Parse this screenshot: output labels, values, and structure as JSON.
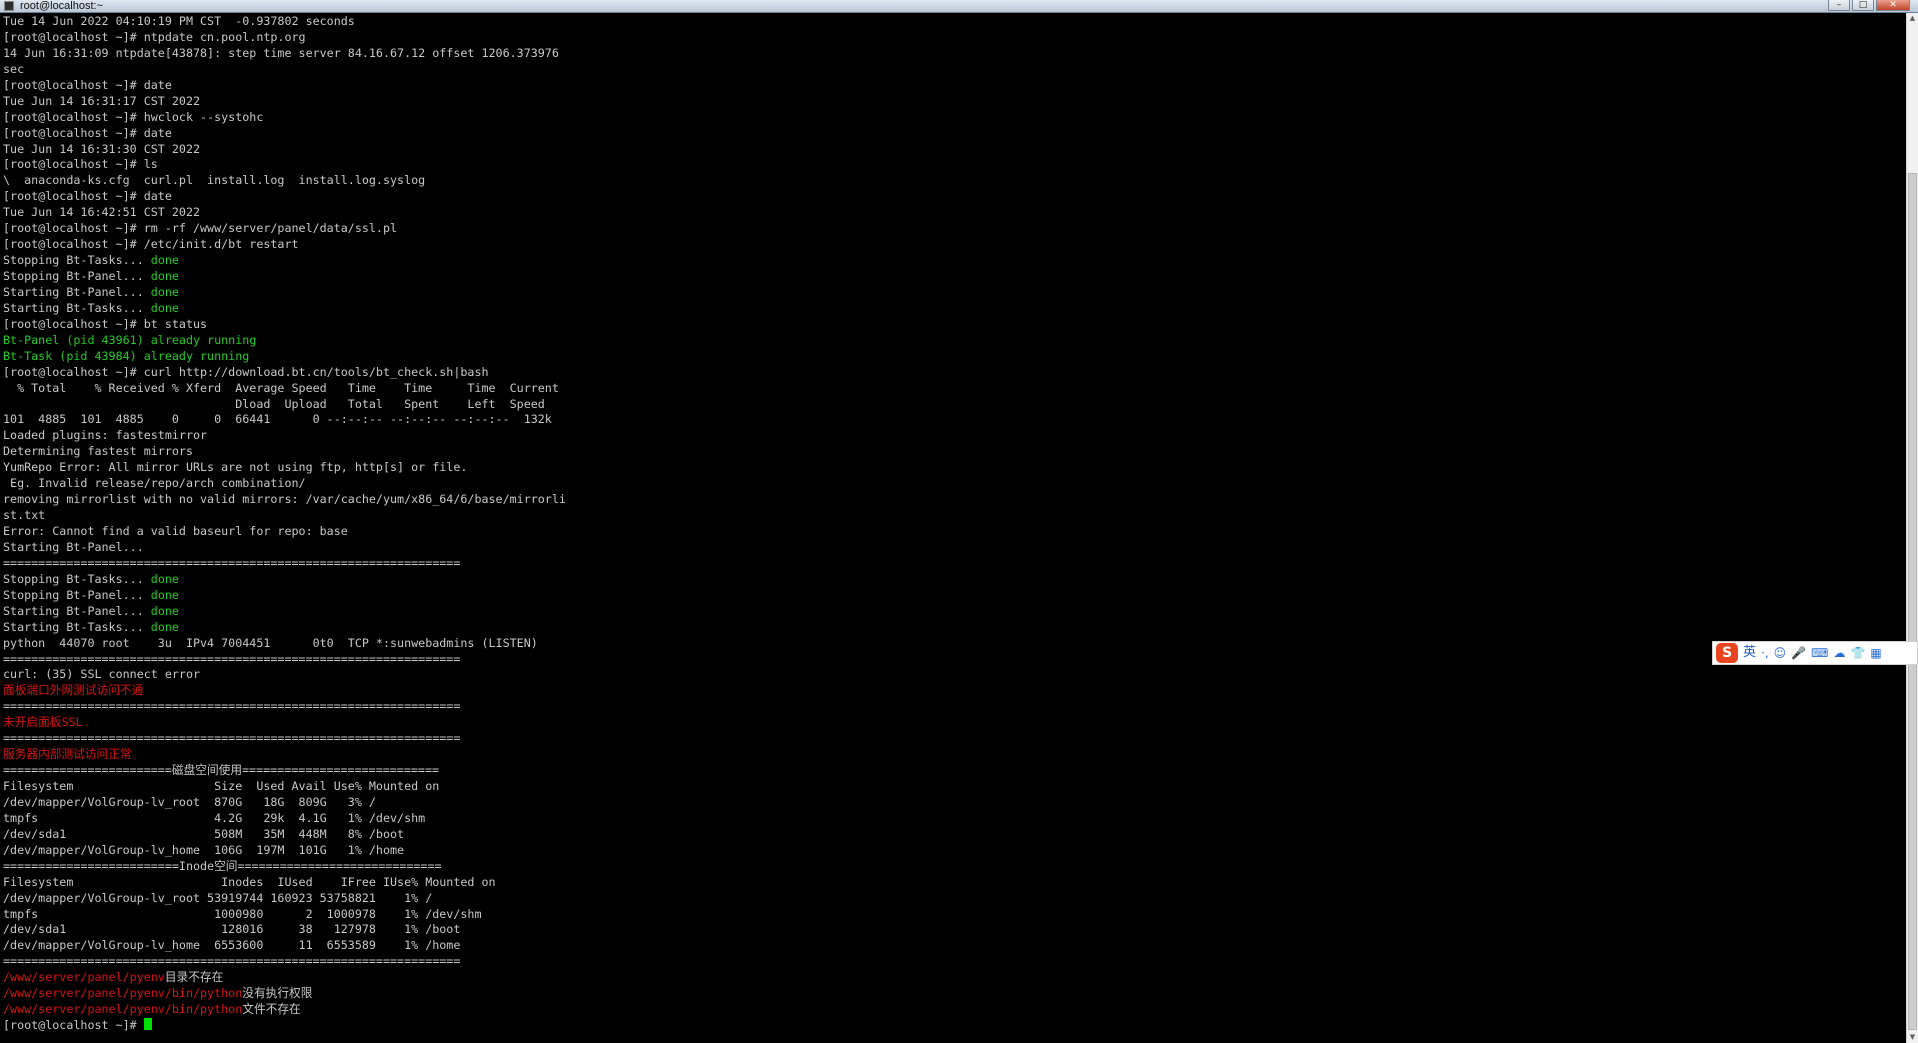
{
  "window": {
    "title": "root@localhost:~",
    "minimize_glyph": "–",
    "maximize_glyph": "□",
    "close_glyph": "✕"
  },
  "terminal": {
    "lines": [
      [
        {
          "t": "Tue 14 Jun 2022 04:10:19 PM CST  -0.937802 seconds"
        }
      ],
      [
        {
          "t": "[root@localhost ~]# ntpdate cn.pool.ntp.org"
        }
      ],
      [
        {
          "t": "14 Jun 16:31:09 ntpdate[43878]: step time server 84.16.67.12 offset 1206.373976"
        }
      ],
      [
        {
          "t": "sec"
        }
      ],
      [
        {
          "t": "[root@localhost ~]# date"
        }
      ],
      [
        {
          "t": "Tue Jun 14 16:31:17 CST 2022"
        }
      ],
      [
        {
          "t": "[root@localhost ~]# hwclock --systohc"
        }
      ],
      [
        {
          "t": "[root@localhost ~]# date"
        }
      ],
      [
        {
          "t": "Tue Jun 14 16:31:30 CST 2022"
        }
      ],
      [
        {
          "t": "[root@localhost ~]# ls"
        }
      ],
      [
        {
          "t": "\\  anaconda-ks.cfg  curl.pl  install.log  install.log.syslog"
        }
      ],
      [
        {
          "t": "[root@localhost ~]# date"
        }
      ],
      [
        {
          "t": "Tue Jun 14 16:42:51 CST 2022"
        }
      ],
      [
        {
          "t": "[root@localhost ~]# rm -rf /www/server/panel/data/ssl.pl"
        }
      ],
      [
        {
          "t": "[root@localhost ~]# /etc/init.d/bt restart"
        }
      ],
      [
        {
          "t": "Stopping Bt-Tasks... "
        },
        {
          "t": "done",
          "c": "g"
        }
      ],
      [
        {
          "t": "Stopping Bt-Panel... "
        },
        {
          "t": "done",
          "c": "g"
        }
      ],
      [
        {
          "t": "Starting Bt-Panel... "
        },
        {
          "t": "done",
          "c": "g"
        }
      ],
      [
        {
          "t": "Starting Bt-Tasks... "
        },
        {
          "t": "done",
          "c": "g"
        }
      ],
      [
        {
          "t": "[root@localhost ~]# bt status"
        }
      ],
      [
        {
          "t": "Bt-Panel (pid 43961) already running",
          "c": "g"
        }
      ],
      [
        {
          "t": "Bt-Task (pid 43984) already running",
          "c": "g"
        }
      ],
      [
        {
          "t": "[root@localhost ~]# curl http://download.bt.cn/tools/bt_check.sh|bash"
        }
      ],
      [
        {
          "t": "  % Total    % Received % Xferd  Average Speed   Time    Time     Time  Current"
        }
      ],
      [
        {
          "t": "                                 Dload  Upload   Total   Spent    Left  Speed"
        }
      ],
      [
        {
          "t": "101  4885  101  4885    0     0  66441      0 --:--:-- --:--:-- --:--:--  132k"
        }
      ],
      [
        {
          "t": "Loaded plugins: fastestmirror"
        }
      ],
      [
        {
          "t": "Determining fastest mirrors"
        }
      ],
      [
        {
          "t": "YumRepo Error: All mirror URLs are not using ftp, http[s] or file."
        }
      ],
      [
        {
          "t": " Eg. Invalid release/repo/arch combination/"
        }
      ],
      [
        {
          "t": "removing mirrorlist with no valid mirrors: /var/cache/yum/x86_64/6/base/mirrorli"
        }
      ],
      [
        {
          "t": "st.txt"
        }
      ],
      [
        {
          "t": "Error: Cannot find a valid baseurl for repo: base"
        }
      ],
      [
        {
          "t": "Starting Bt-Panel..."
        }
      ],
      [
        {
          "t": "================================================================="
        }
      ],
      [
        {
          "t": "Stopping Bt-Tasks... "
        },
        {
          "t": "done",
          "c": "g"
        }
      ],
      [
        {
          "t": "Stopping Bt-Panel... "
        },
        {
          "t": "done",
          "c": "g"
        }
      ],
      [
        {
          "t": "Starting Bt-Panel... "
        },
        {
          "t": "done",
          "c": "g"
        }
      ],
      [
        {
          "t": "Starting Bt-Tasks... "
        },
        {
          "t": "done",
          "c": "g"
        }
      ],
      [
        {
          "t": "python  44070 root    3u  IPv4 7004451      0t0  TCP *:sunwebadmins (LISTEN)"
        }
      ],
      [
        {
          "t": "================================================================="
        }
      ],
      [
        {
          "t": "curl: (35) SSL connect error"
        }
      ],
      [
        {
          "t": "面板端口外网测试访问不通",
          "c": "r"
        }
      ],
      [
        {
          "t": "================================================================="
        }
      ],
      [
        {
          "t": "未开启面板SSL",
          "c": "r"
        }
      ],
      [
        {
          "t": "================================================================="
        }
      ],
      [
        {
          "t": "服务器内部测试访问正常",
          "c": "r"
        }
      ],
      [
        {
          "t": "========================磁盘空间使用============================"
        }
      ],
      [
        {
          "t": "Filesystem                    Size  Used Avail Use% Mounted on"
        }
      ],
      [
        {
          "t": "/dev/mapper/VolGroup-lv_root  870G   18G  809G   3% /"
        }
      ],
      [
        {
          "t": "tmpfs                         4.2G   29k  4.1G   1% /dev/shm"
        }
      ],
      [
        {
          "t": "/dev/sda1                     508M   35M  448M   8% /boot"
        }
      ],
      [
        {
          "t": "/dev/mapper/VolGroup-lv_home  106G  197M  101G   1% /home"
        }
      ],
      [
        {
          "t": "=========================Inode空间============================="
        }
      ],
      [
        {
          "t": "Filesystem                     Inodes  IUsed    IFree IUse% Mounted on"
        }
      ],
      [
        {
          "t": "/dev/mapper/VolGroup-lv_root 53919744 160923 53758821    1% /"
        }
      ],
      [
        {
          "t": "tmpfs                         1000980      2  1000978    1% /dev/shm"
        }
      ],
      [
        {
          "t": "/dev/sda1                      128016     38   127978    1% /boot"
        }
      ],
      [
        {
          "t": "/dev/mapper/VolGroup-lv_home  6553600     11  6553589    1% /home"
        }
      ],
      [
        {
          "t": "================================================================="
        }
      ],
      [
        {
          "t": "/www/server/panel/pyenv",
          "c": "r"
        },
        {
          "t": "目录不存在"
        }
      ],
      [
        {
          "t": "/www/server/panel/pyenv/bin/python",
          "c": "r"
        },
        {
          "t": "没有执行权限"
        }
      ],
      [
        {
          "t": "/www/server/panel/pyenv/bin/python",
          "c": "r"
        },
        {
          "t": "文件不存在"
        }
      ],
      [
        {
          "t": "[root@localhost ~]# "
        },
        {
          "t": "",
          "c": "cursor"
        }
      ]
    ]
  },
  "scrollbar": {
    "up_glyph": "▲",
    "down_glyph": "▼"
  },
  "ime_toolbar": {
    "logo": "S",
    "language": "英",
    "icons": [
      "·,",
      "☺",
      "🎤",
      "⌨",
      "☁",
      "👕",
      "▦"
    ]
  }
}
